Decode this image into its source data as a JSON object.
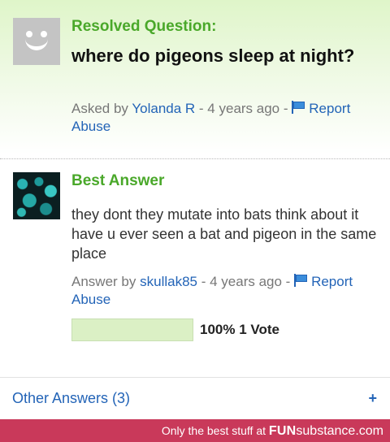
{
  "question": {
    "status_label": "Resolved Question:",
    "title": "where do pigeons sleep at night?",
    "asked_by_prefix": "Asked by",
    "asker": "Yolanda R",
    "age": "- 4 years ago -",
    "report_label": "Report Abuse"
  },
  "best_answer": {
    "label": "Best Answer",
    "body": "they dont they mutate into bats think about it have u ever seen a bat and pigeon in the same place",
    "answer_by_prefix": "Answer by",
    "answerer": "skullak85",
    "age": "- 4 years ago -",
    "report_label": "Report Abuse",
    "vote_fraction": 1.0,
    "vote_text": "100% 1 Vote"
  },
  "other_answers": {
    "label": "Other Answers (3)",
    "expand_symbol": "+"
  },
  "footer": {
    "tagline": "Only the best stuff at",
    "brand_bold": "FUN",
    "brand_rest": "substance",
    "brand_suffix": ".com"
  },
  "colors": {
    "accent_green": "#4aa82a",
    "link_blue": "#2364b7",
    "footer_bg": "#c9395a",
    "vote_fill": "#dbf0c5"
  }
}
